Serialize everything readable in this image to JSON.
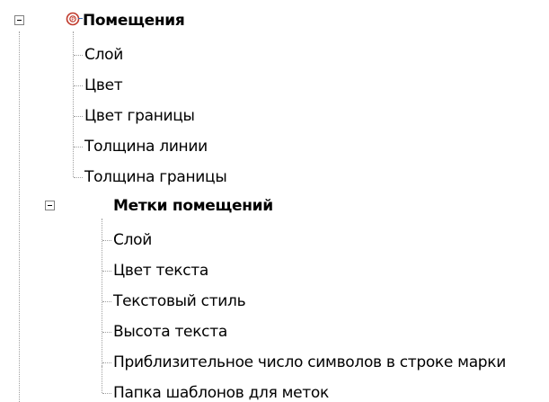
{
  "tree": {
    "root": {
      "label": "Помещения",
      "icon": "room-style-icon",
      "expanded": true,
      "children": [
        {
          "label": "Слой"
        },
        {
          "label": "Цвет"
        },
        {
          "label": "Цвет границы"
        },
        {
          "label": "Толщина линии"
        },
        {
          "label": "Толщина границы"
        }
      ]
    },
    "group": {
      "label": "Метки помещений",
      "expanded": true,
      "children": [
        {
          "label": "Слой"
        },
        {
          "label": "Цвет текста"
        },
        {
          "label": "Текстовый стиль"
        },
        {
          "label": "Высота текста"
        },
        {
          "label": "Приблизительное число символов в строке марки"
        },
        {
          "label": "Папка шаблонов для меток"
        }
      ]
    }
  },
  "colors": {
    "line": "#a0a0a0",
    "icon_red": "#c0392b",
    "icon_blue": "#3c6fb4"
  }
}
